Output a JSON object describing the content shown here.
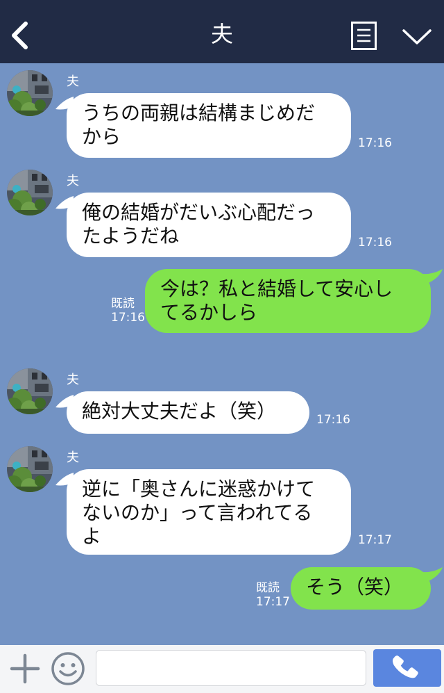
{
  "header": {
    "title": "夫"
  },
  "messages": [
    {
      "type": "in",
      "sender": "夫",
      "text": "うちの両親は結構まじめだ\nから",
      "time": "17:16"
    },
    {
      "type": "in",
      "sender": "夫",
      "text": "俺の結婚がだいぶ心配だっ\nたようだね",
      "time": "17:16"
    },
    {
      "type": "out",
      "read": "既読",
      "time": "17:16",
      "text": "今は？私と結婚して安心し\nてるかしら"
    },
    {
      "type": "in",
      "sender": "夫",
      "text": "絶対大丈夫だよ（笑）",
      "time": "17:16"
    },
    {
      "type": "in",
      "sender": "夫",
      "text": "逆に「奥さんに迷惑かけて\nないのか」って言われてる\nよ",
      "time": "17:17"
    },
    {
      "type": "out",
      "read": "既読",
      "time": "17:17",
      "text": "そう（笑）"
    }
  ],
  "input": {
    "placeholder": "",
    "value": ""
  },
  "icons": {
    "back": "back-arrow-icon",
    "menu": "menu-list-icon",
    "collapse": "chevron-down-icon",
    "plus": "plus-icon",
    "emoji": "smiley-icon",
    "call": "phone-icon"
  },
  "colors": {
    "header": "#212b45",
    "background": "#7393c4",
    "incoming_bubble": "#ffffff",
    "outgoing_bubble": "#82e34c",
    "call_button": "#5a86df"
  }
}
